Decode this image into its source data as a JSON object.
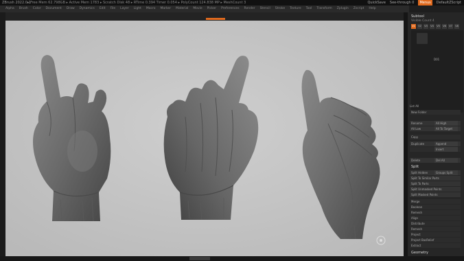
{
  "titlebar": {
    "app": "ZBrush 2022.0.1",
    "status": "▸ Free Mem 62.798GB  ▸ Active Mem 1783  ▸ Scratch Disk 48  ▸ RTime 0.394 Timer 0.054  ▸ PolyCount 124.838 MP  ▸ MeshCount 3",
    "quicksave": "QuickSave",
    "see_through": "See-through 0",
    "menus": "Menus",
    "script": "DefaultZScript"
  },
  "menubar": [
    "Alpha",
    "Brush",
    "Color",
    "Document",
    "Draw",
    "Dynamics",
    "Edit",
    "File",
    "Layer",
    "Light",
    "Macro",
    "Marker",
    "Material",
    "Movie",
    "Picker",
    "Preferences",
    "Render",
    "Stencil",
    "Stroke",
    "Texture",
    "Tool",
    "Transform",
    "Zplugin",
    "Zscript",
    "Help"
  ],
  "panel": {
    "subtool_title": "Subtool",
    "visible_count": "Visible Count 4",
    "icon_labels": [
      "V1",
      "V2",
      "V3",
      "V4",
      "V5",
      "V6",
      "V7",
      "V8"
    ],
    "thumb_caption": "D01",
    "list_label": "List All",
    "rows": [
      {
        "label": "New Folder",
        "val": ""
      },
      {
        "label": "Rename",
        "val": "All High"
      },
      {
        "label": "All Low",
        "val": "All To Target"
      },
      {
        "label": "Copy",
        "val": ""
      },
      {
        "label": "Duplicate",
        "val": "Append"
      },
      {
        "label": "",
        "val": "Insert"
      },
      {
        "label": "Delete",
        "val": "Del All"
      }
    ],
    "split_header": "Split",
    "split_items": [
      "Split Hidden",
      "Groups Split",
      "Split To Similar Parts",
      "Split To Parts",
      "Split Unmasked Points",
      "Split Masked Points",
      "Merge",
      "Boolean",
      "Remesh",
      "Align",
      "Distribute",
      "Remesh",
      "Project",
      "Project BasRelief",
      "Extract"
    ],
    "geometry_header": "Geometry"
  }
}
